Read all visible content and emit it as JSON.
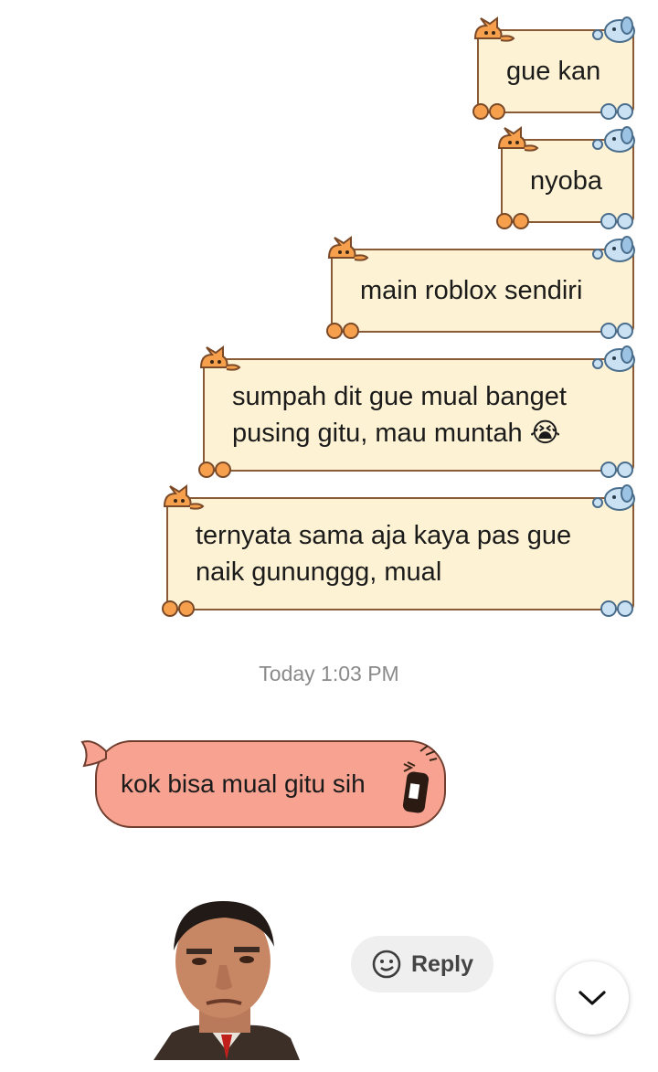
{
  "messages_out": [
    {
      "lines": [
        "gue kan"
      ]
    },
    {
      "lines": [
        "nyoba"
      ]
    },
    {
      "lines": [
        "main roblox sendiri"
      ]
    },
    {
      "lines": [
        "sumpah dit gue mual banget",
        "pusing gitu, mau muntah 😭"
      ]
    },
    {
      "lines": [
        "ternyata sama aja kaya pas gue",
        "naik gununggg, mual"
      ]
    }
  ],
  "timestamp": "Today 1:03 PM",
  "message_in": {
    "text": "kok bisa mual gitu sih"
  },
  "reply_button": {
    "label": "Reply"
  },
  "colors": {
    "out_bubble_bg": "#fdf2d3",
    "out_bubble_border": "#8a5a36",
    "in_bubble_bg": "#f8a391",
    "timestamp_text": "#8a8a8a"
  }
}
